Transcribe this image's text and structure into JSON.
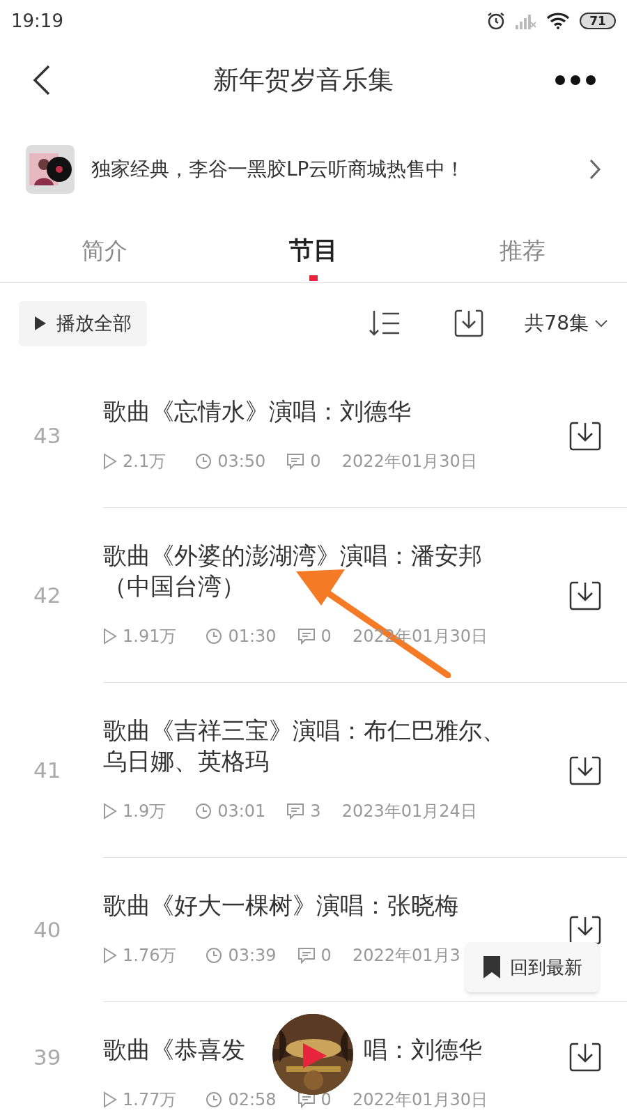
{
  "status_bar": {
    "time": "19:19",
    "battery": "71"
  },
  "header": {
    "title": "新年贺岁音乐集"
  },
  "banner": {
    "text": "独家经典，李谷一黑胶LP云听商城热售中！"
  },
  "tabs": [
    {
      "label": "简介",
      "selected": false
    },
    {
      "label": "节目",
      "selected": true
    },
    {
      "label": "推荐",
      "selected": false
    }
  ],
  "toolbar": {
    "play_all": "播放全部",
    "count": "共78集"
  },
  "episodes": [
    {
      "number": "43",
      "title_parts": [
        "歌曲《忘情水》演唱：刘德华"
      ],
      "plays": "2.1万",
      "duration": "03:50",
      "comments": "0",
      "date": "2022年01月30日"
    },
    {
      "number": "42",
      "title_parts": [
        "歌曲《外婆的澎湖湾》演唱：潘安邦（中国台湾）"
      ],
      "plays": "1.91万",
      "duration": "01:30",
      "comments": "0",
      "date": "2022年01月30日"
    },
    {
      "number": "41",
      "title_parts": [
        "歌曲《吉祥三宝》演唱：布仁巴雅尔、乌日娜、英格玛"
      ],
      "plays": "1.9万",
      "duration": "03:01",
      "comments": "3",
      "date": "2023年01月24日"
    },
    {
      "number": "40",
      "title_parts": [
        "歌曲《好大一棵树》演唱：张晓梅"
      ],
      "plays": "1.76万",
      "duration": "03:39",
      "comments": "0",
      "date": "2022年01月3"
    },
    {
      "number": "39",
      "title_parts": [
        "歌曲《恭喜发",
        "唱：刘德华"
      ],
      "plays": "1.77万",
      "duration": "02:58",
      "comments": "0",
      "date": "2022年01月30日"
    }
  ],
  "back_to_latest": "回到最新"
}
